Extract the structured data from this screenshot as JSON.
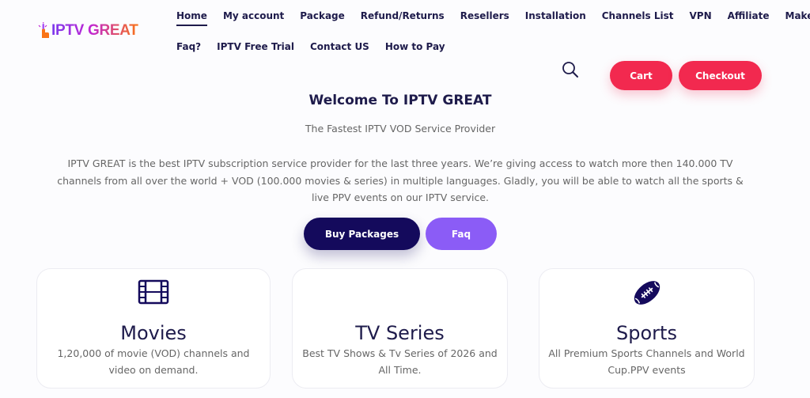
{
  "brand": {
    "name": "IPTV GREAT"
  },
  "nav": {
    "row1": [
      "Home",
      "My account",
      "Package",
      "Refund/Returns",
      "Resellers",
      "Installation",
      "Channels List",
      "VPN",
      "Affiliate",
      "Make $"
    ],
    "row2": [
      "Faq?",
      "IPTV Free Trial",
      "Contact US",
      "How to Pay"
    ],
    "active": "Home"
  },
  "header": {
    "cart_label": "Cart",
    "checkout_label": "Checkout"
  },
  "hero": {
    "title": "Welcome To IPTV GREAT",
    "tagline": "The Fastest IPTV VOD Service Provider",
    "description": "IPTV GREAT is the best IPTV subscription service provider for the last three years. We’re giving access to watch more then 140.000 TV channels from all over the world + VOD (100.000 movies & series) in multiple languages. Gladly, you will be able to watch all the sports & live PPV events on our IPTV service.",
    "buy_label": "Buy Packages",
    "faq_label": "Faq"
  },
  "features": [
    {
      "icon": "film-icon",
      "title": "Movies",
      "text": "1,20,000 of movie (VOD) channels and video on demand."
    },
    {
      "icon": "tv-icon",
      "title": "TV Series",
      "text": "Best TV Shows & Tv Series of 2026 and All Time."
    },
    {
      "icon": "football-icon",
      "title": "Sports",
      "text": "All Premium Sports Channels and World Cup.PPV events"
    }
  ],
  "colors": {
    "accent": "#f2294f",
    "primary": "#140a5c",
    "secondary": "#8b5cf6",
    "text": "#1e1b4b"
  }
}
